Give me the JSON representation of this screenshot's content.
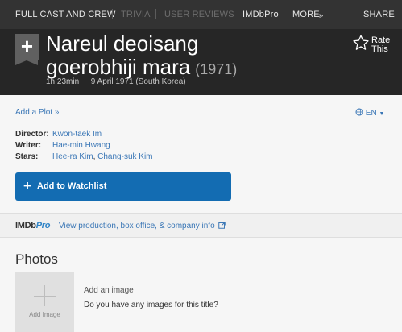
{
  "nav": {
    "full_cast": "FULL CAST AND CREW",
    "trivia": "TRIVIA",
    "user_reviews": "USER REVIEWS",
    "imdbpro": "IMDbPro",
    "more": "MORE",
    "share": "SHARE"
  },
  "title": {
    "line1": "Nareul deoisang",
    "line2": "goerobhiji mara",
    "year": "(1971)",
    "runtime": "1h 23min",
    "release": "9 April 1971 (South Korea)",
    "rate_line1": "Rate",
    "rate_line2": "This"
  },
  "info": {
    "add_plot": "Add a Plot »",
    "language": "EN",
    "director_label": "Director:",
    "director": "Kwon-taek Im",
    "writer_label": "Writer:",
    "writer": "Hae-min Hwang",
    "stars_label": "Stars:",
    "star1": "Hee-ra Kim",
    "star_sep": ",",
    "star2": "Chang-suk Kim",
    "watchlist": "Add to Watchlist"
  },
  "pro": {
    "logo_a": "IMDb",
    "logo_b": "Pro",
    "link": "View production, box office, & company info"
  },
  "photos": {
    "heading": "Photos",
    "tile_caption": "Add Image",
    "add_image": "Add an image",
    "question": "Do you have any images for this title?"
  },
  "colors": {
    "nav_bg": "#333333",
    "hero_bg": "#262626",
    "link": "#3b77b6",
    "watchlist_bg": "#136cb2"
  }
}
